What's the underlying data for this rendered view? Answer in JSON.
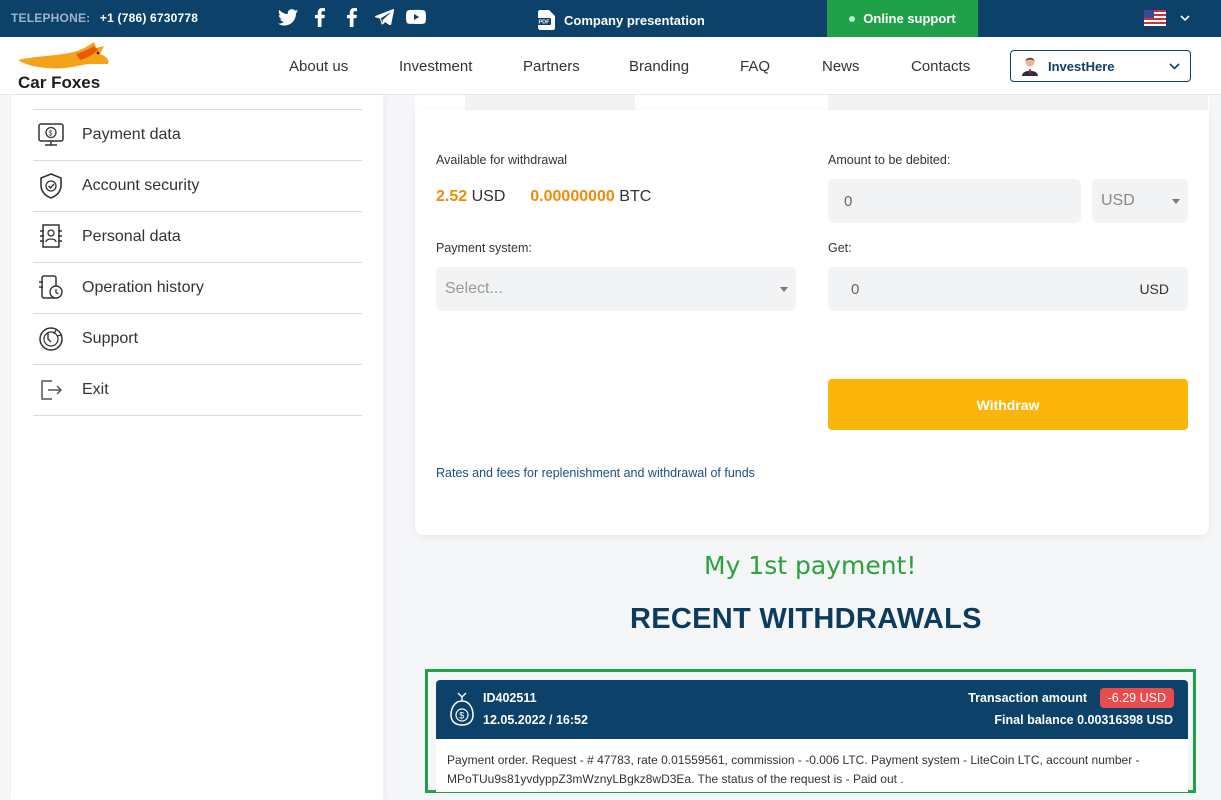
{
  "topbar": {
    "phone_label": "TELEPHONE:",
    "phone": "+1 (786) 6730778",
    "social": [
      "twitter-icon",
      "facebook-icon",
      "facebook-icon",
      "telegram-icon",
      "youtube-icon"
    ],
    "presentation": "Company presentation",
    "online_support": "Online support"
  },
  "header": {
    "brand": "Car Foxes",
    "nav": [
      "About us",
      "Investment",
      "Partners",
      "Branding",
      "FAQ",
      "News",
      "Contacts"
    ],
    "user": "InvestHere"
  },
  "sidebar": {
    "items": [
      {
        "label": "Payment data",
        "icon": "payment-data-icon"
      },
      {
        "label": "Account security",
        "icon": "shield-icon"
      },
      {
        "label": "Personal data",
        "icon": "personal-data-icon"
      },
      {
        "label": "Operation history",
        "icon": "history-icon"
      },
      {
        "label": "Support",
        "icon": "support-icon"
      },
      {
        "label": "Exit",
        "icon": "exit-icon"
      }
    ]
  },
  "form": {
    "available_label": "Available for withdrawal",
    "usd_amount": "2.52",
    "usd_unit": "USD",
    "btc_amount": "0.00000000",
    "btc_unit": "BTC",
    "debit_label": "Amount to be debited:",
    "debit_value": "0",
    "currency": "USD",
    "payment_label": "Payment system:",
    "payment_placeholder": "Select...",
    "get_label": "Get:",
    "get_value": "0",
    "get_unit": "USD",
    "withdraw_button": "Withdraw",
    "rates_link": "Rates and fees for replenishment and withdrawal of funds"
  },
  "annotation": "My 1st payment!",
  "recent": {
    "title": "RECENT WITHDRAWALS",
    "items": [
      {
        "id": "ID402511",
        "datetime": "12.05.2022 / 16:52",
        "amount_label": "Transaction amount",
        "amount": "-6.29 USD",
        "final_balance": "Final balance 0.00316398 USD",
        "description": "Payment order. Request - # 47783, rate 0.01559561, commission - -0.006 LTC. Payment system - LiteCoin LTC, account number - MPoTUu9s81yvdyppZ3mWznyLBgkz8wD3Ea. The status of the request is - Paid out ."
      }
    ]
  },
  "colors": {
    "navy": "#0c4169",
    "green": "#21a04a",
    "orange": "#f28a0a",
    "button": "#fbb40a",
    "badge": "#e84c4c"
  }
}
